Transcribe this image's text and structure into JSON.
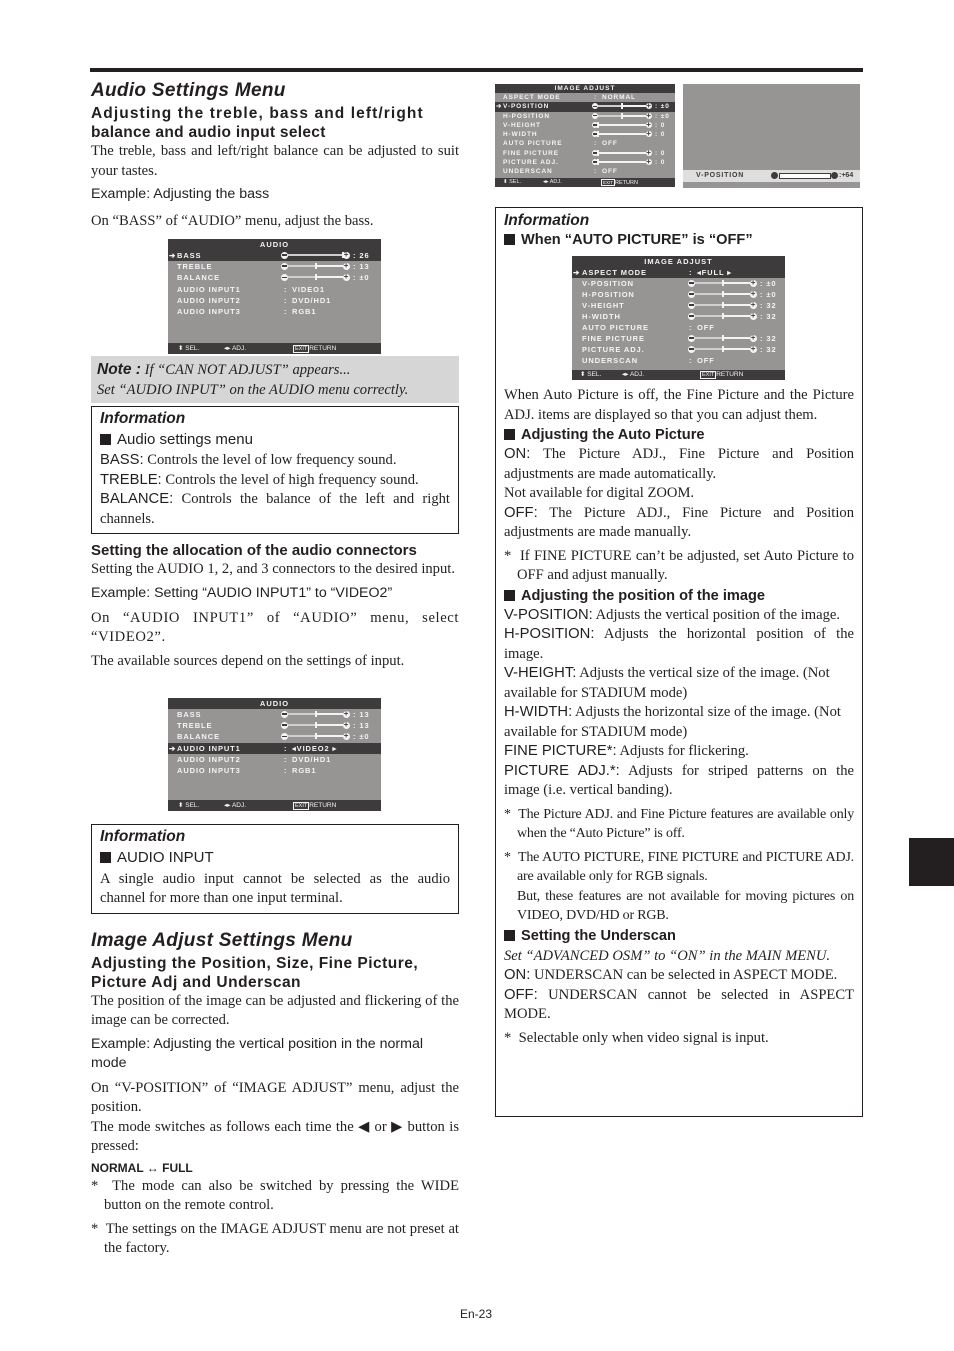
{
  "page": {
    "number": "En-23"
  },
  "left": {
    "audio_title": "Audio Settings Menu",
    "audio_subtitle_line1": "Adjusting the treble, bass and left/right",
    "audio_subtitle_line2": "balance and audio input select",
    "audio_intro": "The treble, bass and left/right balance can be adjusted to suit your tastes.",
    "example_bass": "Example: Adjusting the bass",
    "bass_instruction": "On “BASS” of “AUDIO” menu, adjust the bass.",
    "note_label": "Note :",
    "note_line1": "If “CAN NOT ADJUST” appears...",
    "note_line2": "Set “AUDIO INPUT” on the AUDIO menu correctly.",
    "info1": {
      "title": "Information",
      "heading": "Audio settings menu",
      "items": [
        {
          "term": "BASS:",
          "desc": " Controls the level of low frequency sound."
        },
        {
          "term": "TREBLE:",
          "desc": " Controls the level of high frequency sound."
        },
        {
          "term": "BALANCE:",
          "desc": " Controls the balance of the left and right channels."
        }
      ]
    },
    "alloc_heading": "Setting the allocation of the audio connectors",
    "alloc_text": "Setting the AUDIO 1, 2, and 3 connectors to the desired input.",
    "example_input": "Example: Setting “AUDIO INPUT1” to “VIDEO2”",
    "input_instruction": "On “AUDIO INPUT1” of “AUDIO” menu, select “VIDEO2”.",
    "sources_note": "The available sources depend on the settings of input.",
    "info2": {
      "title": "Information",
      "heading": "AUDIO INPUT",
      "text": "A single audio input cannot be selected as the audio channel for more than one input terminal."
    },
    "image_title": "Image Adjust Settings Menu",
    "image_subtitle_line1": "Adjusting the Position, Size, Fine Picture,",
    "image_subtitle_line2": "Picture Adj and Underscan",
    "image_intro": "The position of the image can be adjusted and flickering of the image can be corrected.",
    "example_vpos": "Example: Adjusting the vertical position in the normal mode",
    "vpos_instruction": "On “V-POSITION” of “IMAGE ADJUST” menu, adjust the position.",
    "mode_switch_a": "The mode switches as follows each time the ",
    "mode_switch_or": " or ",
    "mode_switch_b": " button is pressed:",
    "mode_sequence": "NORMAL ↔ FULL",
    "star_notes": [
      "The mode can also be switched by pressing the WIDE button on the remote control.",
      "The settings on the IMAGE ADJUST menu are not preset at the factory."
    ]
  },
  "osd_audio_bass": {
    "title": "AUDIO",
    "rows": [
      {
        "label": "BASS",
        "type": "slider",
        "value": "26",
        "level": 1.0,
        "selected": true,
        "left_icon": "minus",
        "right_icon": "plus"
      },
      {
        "label": "TREBLE",
        "type": "slider",
        "value": "13",
        "level": 0.5,
        "selected": false,
        "left_icon": "minus",
        "right_icon": "plus"
      },
      {
        "label": "BALANCE",
        "type": "slider",
        "value": "±0",
        "level": 0.5,
        "selected": false,
        "left_icon": "L",
        "right_icon": "R"
      },
      {
        "label": "AUDIO INPUT1",
        "type": "option",
        "value": "VIDEO1",
        "selected": false
      },
      {
        "label": "AUDIO INPUT2",
        "type": "option",
        "value": "DVD/HD1",
        "selected": false
      },
      {
        "label": "AUDIO INPUT3",
        "type": "option",
        "value": "RGB1",
        "selected": false
      }
    ],
    "footer": {
      "sel": "SEL.",
      "adj": "ADJ.",
      "exit": "EXIT",
      "return": "RETURN"
    }
  },
  "osd_audio_input": {
    "title": "AUDIO",
    "rows": [
      {
        "label": "BASS",
        "type": "slider",
        "value": "13",
        "level": 0.5,
        "selected": false,
        "left_icon": "minus",
        "right_icon": "plus"
      },
      {
        "label": "TREBLE",
        "type": "slider",
        "value": "13",
        "level": 0.5,
        "selected": false,
        "left_icon": "minus",
        "right_icon": "plus"
      },
      {
        "label": "BALANCE",
        "type": "slider",
        "value": "±0",
        "level": 0.5,
        "selected": false,
        "left_icon": "L",
        "right_icon": "R"
      },
      {
        "label": "AUDIO INPUT1",
        "type": "option",
        "value": "VIDEO2",
        "selected": true,
        "arrows": true
      },
      {
        "label": "AUDIO INPUT2",
        "type": "option",
        "value": "DVD/HD1",
        "selected": false
      },
      {
        "label": "AUDIO INPUT3",
        "type": "option",
        "value": "RGB1",
        "selected": false
      }
    ],
    "footer": {
      "sel": "SEL.",
      "adj": "ADJ.",
      "exit": "EXIT",
      "return": "RETURN"
    }
  },
  "osd_image_normal": {
    "title": "IMAGE ADJUST",
    "rows": [
      {
        "label": "ASPECT MODE",
        "type": "option",
        "value": "NORMAL",
        "selected": false
      },
      {
        "label": "V-POSITION",
        "type": "slider",
        "value": "±0",
        "level": 0.5,
        "selected": true,
        "left_icon": "minus",
        "right_icon": "plus"
      },
      {
        "label": "H-POSITION",
        "type": "slider",
        "value": "±0",
        "level": 0.5,
        "selected": false,
        "left_icon": "minus",
        "right_icon": "plus"
      },
      {
        "label": "V-HEIGHT",
        "type": "slider",
        "value": "0",
        "level": 0.0,
        "selected": false,
        "left_icon": "minus",
        "right_icon": "plus"
      },
      {
        "label": "H-WIDTH",
        "type": "slider",
        "value": "0",
        "level": 0.0,
        "selected": false,
        "left_icon": "minus",
        "right_icon": "plus"
      },
      {
        "label": "AUTO PICTURE",
        "type": "option",
        "value": "OFF",
        "selected": false
      },
      {
        "label": "FINE PICTURE",
        "type": "slider",
        "value": "0",
        "level": 0.0,
        "selected": false,
        "left_icon": "minus",
        "right_icon": "plus"
      },
      {
        "label": "PICTURE ADJ.",
        "type": "slider",
        "value": "0",
        "level": 0.0,
        "selected": false,
        "left_icon": "minus",
        "right_icon": "plus"
      },
      {
        "label": "UNDERSCAN",
        "type": "option",
        "value": "OFF",
        "selected": false
      }
    ],
    "footer": {
      "sel": "SEL.",
      "adj": "ADJ.",
      "exit": "EXIT",
      "return": "RETURN"
    }
  },
  "osd_vposition_strip": {
    "label": "V-POSITION",
    "value": "+64",
    "level": 1.0
  },
  "right": {
    "info_title": "Information",
    "auto_off_heading": "When “AUTO PICTURE” is “OFF”",
    "auto_off_text": "When Auto Picture is off, the Fine Picture and the Picture ADJ. items are displayed so that you can adjust them.",
    "auto_heading": "Adjusting the Auto Picture",
    "auto_on_term": "ON:",
    "auto_on_text": " The Picture ADJ., Fine Picture and Position adjustments are made automatically.",
    "auto_on_extra": "Not available for digital ZOOM.",
    "auto_off_term": "OFF:",
    "auto_off_desc": " The Picture ADJ., Fine Picture and Position adjustments are made manually.",
    "auto_star": "If FINE PICTURE can’t be adjusted, set Auto Picture to OFF and adjust manually.",
    "position_heading": "Adjusting the position of the image",
    "position_items": [
      {
        "term": "V-POSITION:",
        "desc": " Adjusts the vertical position of the image."
      },
      {
        "term": "H-POSITION:",
        "desc": " Adjusts the horizontal position of the image."
      },
      {
        "term": "V-HEIGHT:",
        "desc": " Adjusts the vertical size of the image. (Not available for STADIUM mode)"
      },
      {
        "term": "H-WIDTH:",
        "desc": " Adjusts the horizontal size of the image. (Not available for STADIUM mode)"
      },
      {
        "term": "FINE PICTURE*:",
        "desc": " Adjusts for flickering."
      },
      {
        "term": "PICTURE ADJ.*:",
        "desc": " Adjusts for striped patterns on the image (i.e. vertical banding)."
      }
    ],
    "position_star1": "The Picture ADJ. and Fine Picture features are available only when the “Auto Picture” is off.",
    "position_star2a": "The AUTO PICTURE, FINE PICTURE and PICTURE ADJ. are available only for RGB signals.",
    "position_star2b": "But, these features are not available for moving pictures on VIDEO, DVD/HD or RGB.",
    "underscan_heading": "Setting the Underscan",
    "underscan_note": "Set “ADVANCED OSM” to “ON” in the MAIN MENU.",
    "underscan_on_term": "ON:",
    "underscan_on_text": " UNDERSCAN can be selected in ASPECT MODE.",
    "underscan_off_term": "OFF:",
    "underscan_off_text": " UNDERSCAN cannot be selected in ASPECT MODE.",
    "underscan_star": "Selectable only when video signal is input."
  },
  "osd_image_full": {
    "title": "IMAGE ADJUST",
    "rows": [
      {
        "label": "ASPECT MODE",
        "type": "option",
        "value": "FULL",
        "selected": true,
        "arrows": true
      },
      {
        "label": "V-POSITION",
        "type": "slider",
        "value": "±0",
        "level": 0.5,
        "selected": false,
        "left_icon": "minus",
        "right_icon": "plus"
      },
      {
        "label": "H-POSITION",
        "type": "slider",
        "value": "±0",
        "level": 0.5,
        "selected": false,
        "left_icon": "minus",
        "right_icon": "plus"
      },
      {
        "label": "V-HEIGHT",
        "type": "slider",
        "value": "32",
        "level": 0.5,
        "selected": false,
        "left_icon": "minus",
        "right_icon": "plus"
      },
      {
        "label": "H-WIDTH",
        "type": "slider",
        "value": "32",
        "level": 0.5,
        "selected": false,
        "left_icon": "minus",
        "right_icon": "plus"
      },
      {
        "label": "AUTO PICTURE",
        "type": "option",
        "value": "OFF",
        "selected": false
      },
      {
        "label": "FINE PICTURE",
        "type": "slider",
        "value": "32",
        "level": 0.5,
        "selected": false,
        "left_icon": "minus",
        "right_icon": "plus"
      },
      {
        "label": "PICTURE ADJ.",
        "type": "slider",
        "value": "32",
        "level": 0.5,
        "selected": false,
        "left_icon": "minus",
        "right_icon": "plus"
      },
      {
        "label": "UNDERSCAN",
        "type": "option",
        "value": "OFF",
        "selected": false
      }
    ],
    "footer": {
      "sel": "SEL.",
      "adj": "ADJ.",
      "exit": "EXIT",
      "return": "RETURN"
    }
  }
}
